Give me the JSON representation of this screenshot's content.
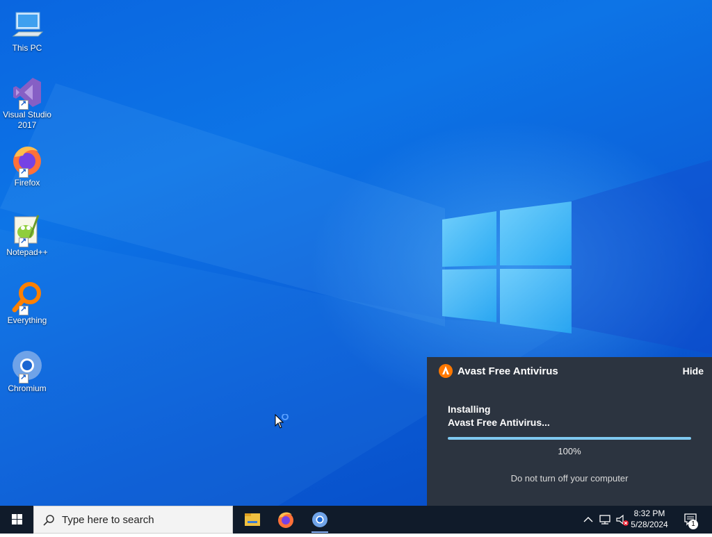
{
  "desktop": {
    "icons": [
      {
        "label": "This PC",
        "icon": "computer-icon"
      },
      {
        "label": "Visual Studio 2017",
        "icon": "visual-studio-icon"
      },
      {
        "label": "Firefox",
        "icon": "firefox-icon"
      },
      {
        "label": "Notepad++",
        "icon": "notepadpp-icon"
      },
      {
        "label": "Everything",
        "icon": "everything-icon"
      },
      {
        "label": "Chromium",
        "icon": "chromium-icon"
      }
    ]
  },
  "avast": {
    "title": "Avast Free Antivirus",
    "hide_label": "Hide",
    "status_line1": "Installing",
    "status_line2": "Avast Free Antivirus...",
    "progress_percent": 100,
    "progress_label": "100%",
    "note": "Do not turn off your computer",
    "accent_color": "#ff7800"
  },
  "taskbar": {
    "search_placeholder": "Type here to search",
    "pinned": [
      "file-explorer-icon",
      "firefox-icon",
      "chromium-icon"
    ],
    "time": "8:32 PM",
    "date": "5/28/2024",
    "notification_count": "1"
  }
}
